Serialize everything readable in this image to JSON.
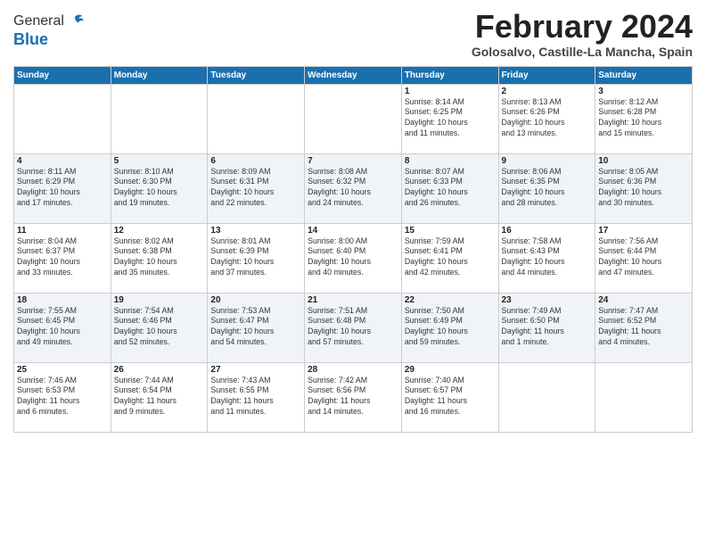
{
  "header": {
    "logo_line1": "General",
    "logo_line2": "Blue",
    "month_title": "February 2024",
    "location": "Golosalvo, Castille-La Mancha, Spain"
  },
  "days_of_week": [
    "Sunday",
    "Monday",
    "Tuesday",
    "Wednesday",
    "Thursday",
    "Friday",
    "Saturday"
  ],
  "weeks": [
    [
      {
        "day": "",
        "info": ""
      },
      {
        "day": "",
        "info": ""
      },
      {
        "day": "",
        "info": ""
      },
      {
        "day": "",
        "info": ""
      },
      {
        "day": "1",
        "info": "Sunrise: 8:14 AM\nSunset: 6:25 PM\nDaylight: 10 hours\nand 11 minutes."
      },
      {
        "day": "2",
        "info": "Sunrise: 8:13 AM\nSunset: 6:26 PM\nDaylight: 10 hours\nand 13 minutes."
      },
      {
        "day": "3",
        "info": "Sunrise: 8:12 AM\nSunset: 6:28 PM\nDaylight: 10 hours\nand 15 minutes."
      }
    ],
    [
      {
        "day": "4",
        "info": "Sunrise: 8:11 AM\nSunset: 6:29 PM\nDaylight: 10 hours\nand 17 minutes."
      },
      {
        "day": "5",
        "info": "Sunrise: 8:10 AM\nSunset: 6:30 PM\nDaylight: 10 hours\nand 19 minutes."
      },
      {
        "day": "6",
        "info": "Sunrise: 8:09 AM\nSunset: 6:31 PM\nDaylight: 10 hours\nand 22 minutes."
      },
      {
        "day": "7",
        "info": "Sunrise: 8:08 AM\nSunset: 6:32 PM\nDaylight: 10 hours\nand 24 minutes."
      },
      {
        "day": "8",
        "info": "Sunrise: 8:07 AM\nSunset: 6:33 PM\nDaylight: 10 hours\nand 26 minutes."
      },
      {
        "day": "9",
        "info": "Sunrise: 8:06 AM\nSunset: 6:35 PM\nDaylight: 10 hours\nand 28 minutes."
      },
      {
        "day": "10",
        "info": "Sunrise: 8:05 AM\nSunset: 6:36 PM\nDaylight: 10 hours\nand 30 minutes."
      }
    ],
    [
      {
        "day": "11",
        "info": "Sunrise: 8:04 AM\nSunset: 6:37 PM\nDaylight: 10 hours\nand 33 minutes."
      },
      {
        "day": "12",
        "info": "Sunrise: 8:02 AM\nSunset: 6:38 PM\nDaylight: 10 hours\nand 35 minutes."
      },
      {
        "day": "13",
        "info": "Sunrise: 8:01 AM\nSunset: 6:39 PM\nDaylight: 10 hours\nand 37 minutes."
      },
      {
        "day": "14",
        "info": "Sunrise: 8:00 AM\nSunset: 6:40 PM\nDaylight: 10 hours\nand 40 minutes."
      },
      {
        "day": "15",
        "info": "Sunrise: 7:59 AM\nSunset: 6:41 PM\nDaylight: 10 hours\nand 42 minutes."
      },
      {
        "day": "16",
        "info": "Sunrise: 7:58 AM\nSunset: 6:43 PM\nDaylight: 10 hours\nand 44 minutes."
      },
      {
        "day": "17",
        "info": "Sunrise: 7:56 AM\nSunset: 6:44 PM\nDaylight: 10 hours\nand 47 minutes."
      }
    ],
    [
      {
        "day": "18",
        "info": "Sunrise: 7:55 AM\nSunset: 6:45 PM\nDaylight: 10 hours\nand 49 minutes."
      },
      {
        "day": "19",
        "info": "Sunrise: 7:54 AM\nSunset: 6:46 PM\nDaylight: 10 hours\nand 52 minutes."
      },
      {
        "day": "20",
        "info": "Sunrise: 7:53 AM\nSunset: 6:47 PM\nDaylight: 10 hours\nand 54 minutes."
      },
      {
        "day": "21",
        "info": "Sunrise: 7:51 AM\nSunset: 6:48 PM\nDaylight: 10 hours\nand 57 minutes."
      },
      {
        "day": "22",
        "info": "Sunrise: 7:50 AM\nSunset: 6:49 PM\nDaylight: 10 hours\nand 59 minutes."
      },
      {
        "day": "23",
        "info": "Sunrise: 7:49 AM\nSunset: 6:50 PM\nDaylight: 11 hours\nand 1 minute."
      },
      {
        "day": "24",
        "info": "Sunrise: 7:47 AM\nSunset: 6:52 PM\nDaylight: 11 hours\nand 4 minutes."
      }
    ],
    [
      {
        "day": "25",
        "info": "Sunrise: 7:46 AM\nSunset: 6:53 PM\nDaylight: 11 hours\nand 6 minutes."
      },
      {
        "day": "26",
        "info": "Sunrise: 7:44 AM\nSunset: 6:54 PM\nDaylight: 11 hours\nand 9 minutes."
      },
      {
        "day": "27",
        "info": "Sunrise: 7:43 AM\nSunset: 6:55 PM\nDaylight: 11 hours\nand 11 minutes."
      },
      {
        "day": "28",
        "info": "Sunrise: 7:42 AM\nSunset: 6:56 PM\nDaylight: 11 hours\nand 14 minutes."
      },
      {
        "day": "29",
        "info": "Sunrise: 7:40 AM\nSunset: 6:57 PM\nDaylight: 11 hours\nand 16 minutes."
      },
      {
        "day": "",
        "info": ""
      },
      {
        "day": "",
        "info": ""
      }
    ]
  ]
}
